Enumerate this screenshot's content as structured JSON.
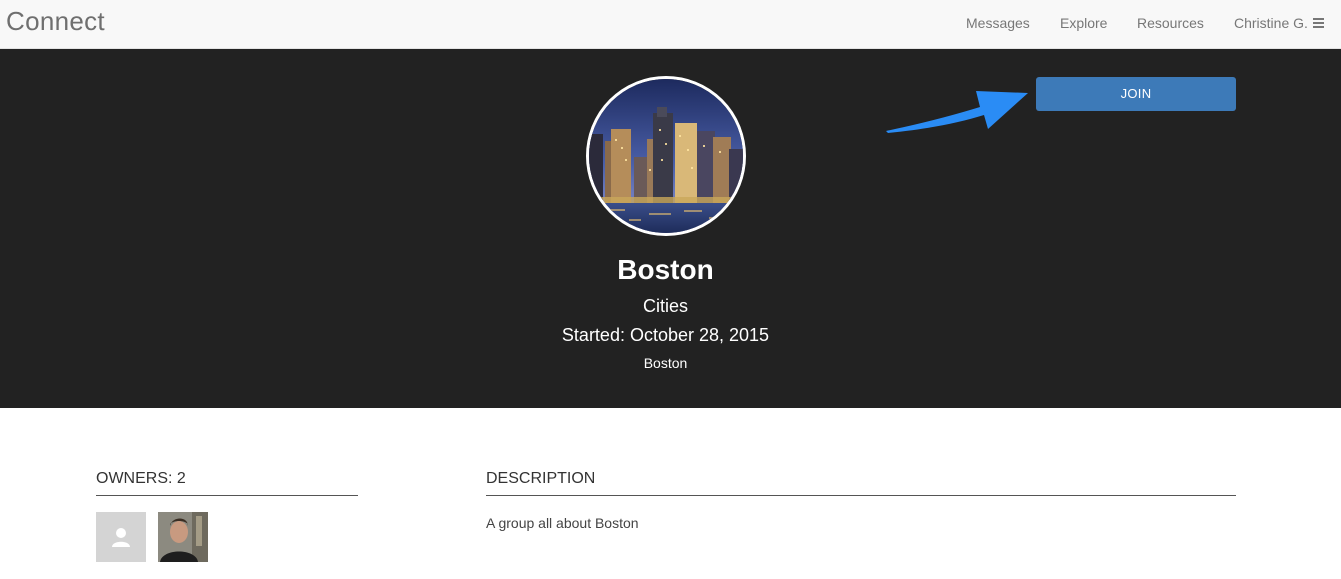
{
  "navbar": {
    "brand": "Connect",
    "links": {
      "messages": "Messages",
      "explore": "Explore",
      "resources": "Resources",
      "user": "Christine G."
    },
    "menu_icon": "hamburger-icon"
  },
  "group": {
    "name": "Boston",
    "category": "Cities",
    "started": "Started: October 28, 2015",
    "location": "Boston",
    "join_label": "JOIN",
    "avatar_icon": "boston-skyline-photo"
  },
  "owners": {
    "heading": "OWNERS: 2"
  },
  "description": {
    "heading": "DESCRIPTION",
    "text": "A group all about Boston"
  },
  "colors": {
    "hero_bg": "#222222",
    "join_button": "#3d7ab8",
    "annotation_arrow": "#2a8cf5"
  }
}
